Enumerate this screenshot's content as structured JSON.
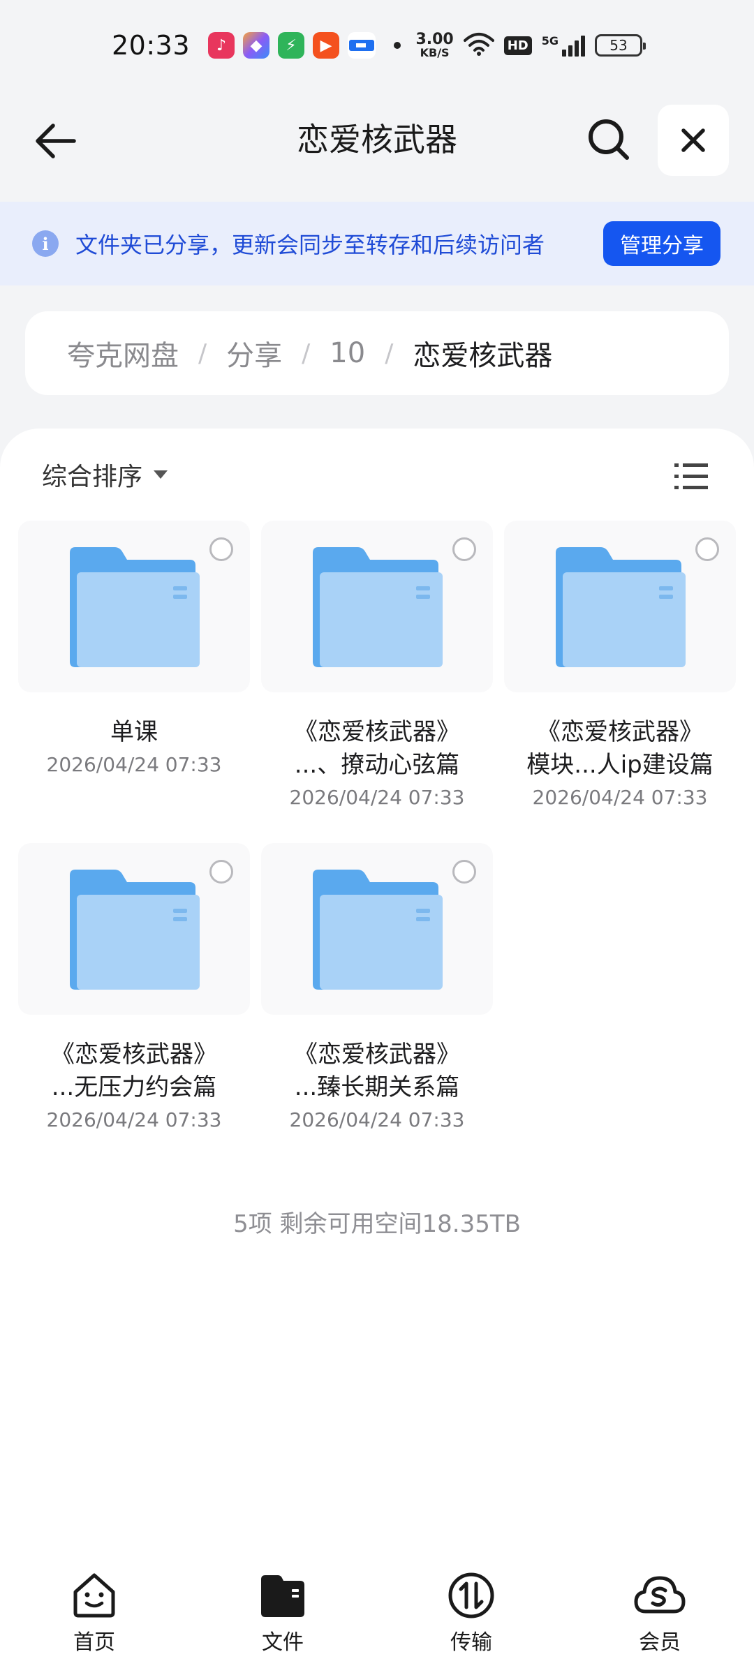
{
  "status_bar": {
    "time": "20:33",
    "net_speed_value": "3.00",
    "net_speed_unit": "KB/S",
    "hd": "HD",
    "network": "5G",
    "battery": "53"
  },
  "header": {
    "title": "恋爱核武器",
    "back_icon": "back-arrow-icon",
    "search_icon": "search-icon",
    "close_icon": "close-icon"
  },
  "share_banner": {
    "text": "文件夹已分享，更新会同步至转存和后续访问者",
    "button_label": "管理分享",
    "accent": "#1556f0"
  },
  "breadcrumb": {
    "items": [
      "夸克网盘",
      "分享",
      "10",
      "恋爱核武器"
    ],
    "separator": "/"
  },
  "toolbar": {
    "sort_label": "综合排序"
  },
  "files": [
    {
      "name_line1": "单课",
      "name_line2": "",
      "date": "2026/04/24 07:33"
    },
    {
      "name_line1": "《恋爱核武器》",
      "name_line2": "...、撩动心弦篇",
      "date": "2026/04/24 07:33"
    },
    {
      "name_line1": "《恋爱核武器》",
      "name_line2": "模块...人ip建设篇",
      "date": "2026/04/24 07:33"
    },
    {
      "name_line1": "《恋爱核武器》",
      "name_line2": "...无压力约会篇",
      "date": "2026/04/24 07:33"
    },
    {
      "name_line1": "《恋爱核武器》",
      "name_line2": "...臻长期关系篇",
      "date": "2026/04/24 07:33"
    }
  ],
  "summary": "5项 剩余可用空间18.35TB",
  "bottom_nav": [
    {
      "label": "首页",
      "icon": "home-icon"
    },
    {
      "label": "文件",
      "icon": "folder-icon",
      "active": true
    },
    {
      "label": "传输",
      "icon": "transfer-icon"
    },
    {
      "label": "会员",
      "icon": "membership-icon"
    }
  ]
}
